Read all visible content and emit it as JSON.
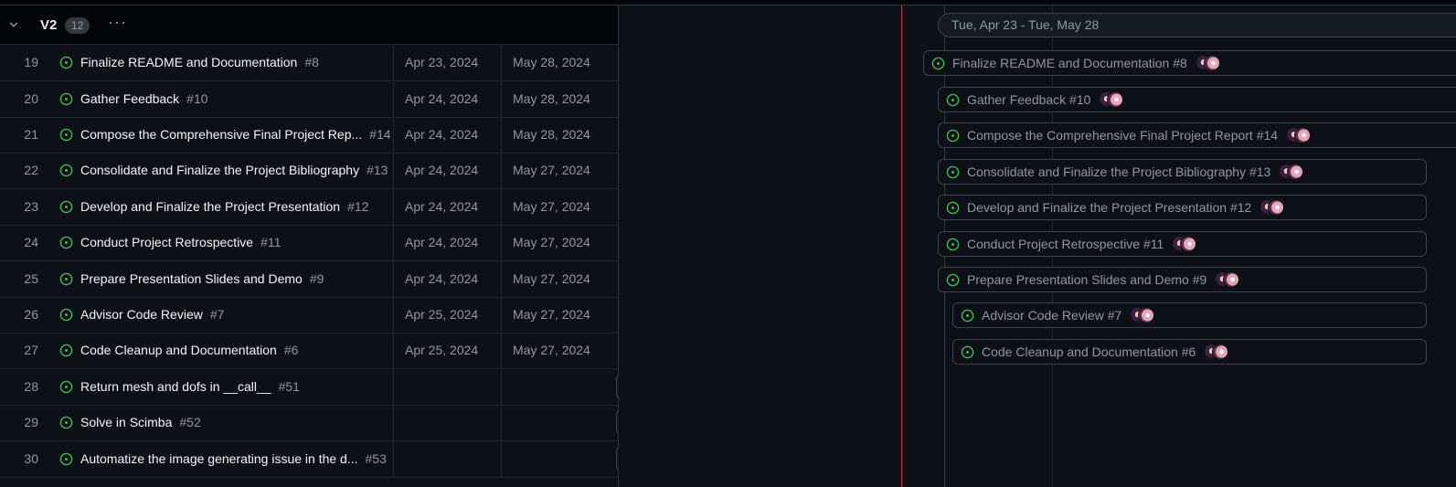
{
  "group": {
    "title": "V2",
    "count": "12",
    "more": "···"
  },
  "range_label": "Tue, Apr 23 - Tue, May 28",
  "rows": [
    {
      "index": "19",
      "title": "Finalize README and Documentation",
      "number": "#8",
      "start": "Apr 23, 2024",
      "end": "May 28, 2024",
      "bar_label": "Finalize README and Documentation #8"
    },
    {
      "index": "20",
      "title": "Gather Feedback",
      "number": "#10",
      "start": "Apr 24, 2024",
      "end": "May 28, 2024",
      "bar_label": "Gather Feedback #10"
    },
    {
      "index": "21",
      "title": "Compose the Comprehensive Final Project Rep...",
      "number": "#14",
      "start": "Apr 24, 2024",
      "end": "May 28, 2024",
      "bar_label": "Compose the Comprehensive Final Project Report #14"
    },
    {
      "index": "22",
      "title": "Consolidate and Finalize the Project Bibliography",
      "number": "#13",
      "start": "Apr 24, 2024",
      "end": "May 27, 2024",
      "bar_label": "Consolidate and Finalize the Project Bibliography #13"
    },
    {
      "index": "23",
      "title": "Develop and Finalize the Project Presentation",
      "number": "#12",
      "start": "Apr 24, 2024",
      "end": "May 27, 2024",
      "bar_label": "Develop and Finalize the Project Presentation #12"
    },
    {
      "index": "24",
      "title": "Conduct Project Retrospective",
      "number": "#11",
      "start": "Apr 24, 2024",
      "end": "May 27, 2024",
      "bar_label": "Conduct Project Retrospective #11"
    },
    {
      "index": "25",
      "title": "Prepare Presentation Slides and Demo",
      "number": "#9",
      "start": "Apr 24, 2024",
      "end": "May 27, 2024",
      "bar_label": "Prepare Presentation Slides and Demo #9"
    },
    {
      "index": "26",
      "title": "Advisor Code Review",
      "number": "#7",
      "start": "Apr 25, 2024",
      "end": "May 27, 2024",
      "bar_label": "Advisor Code Review #7"
    },
    {
      "index": "27",
      "title": "Code Cleanup and Documentation",
      "number": "#6",
      "start": "Apr 25, 2024",
      "end": "May 27, 2024",
      "bar_label": "Code Cleanup and Documentation #6"
    },
    {
      "index": "28",
      "title": "Return mesh and dofs in __call__",
      "number": "#51",
      "start": "",
      "end": ""
    },
    {
      "index": "29",
      "title": "Solve in Scimba",
      "number": "#52",
      "start": "",
      "end": ""
    },
    {
      "index": "30",
      "title": "Automatize the image generating issue in the d...",
      "number": "#53",
      "start": "",
      "end": ""
    }
  ],
  "colors": {
    "status_open": "#3fb950",
    "today_line": "#c93c37",
    "background": "#0d1117"
  }
}
